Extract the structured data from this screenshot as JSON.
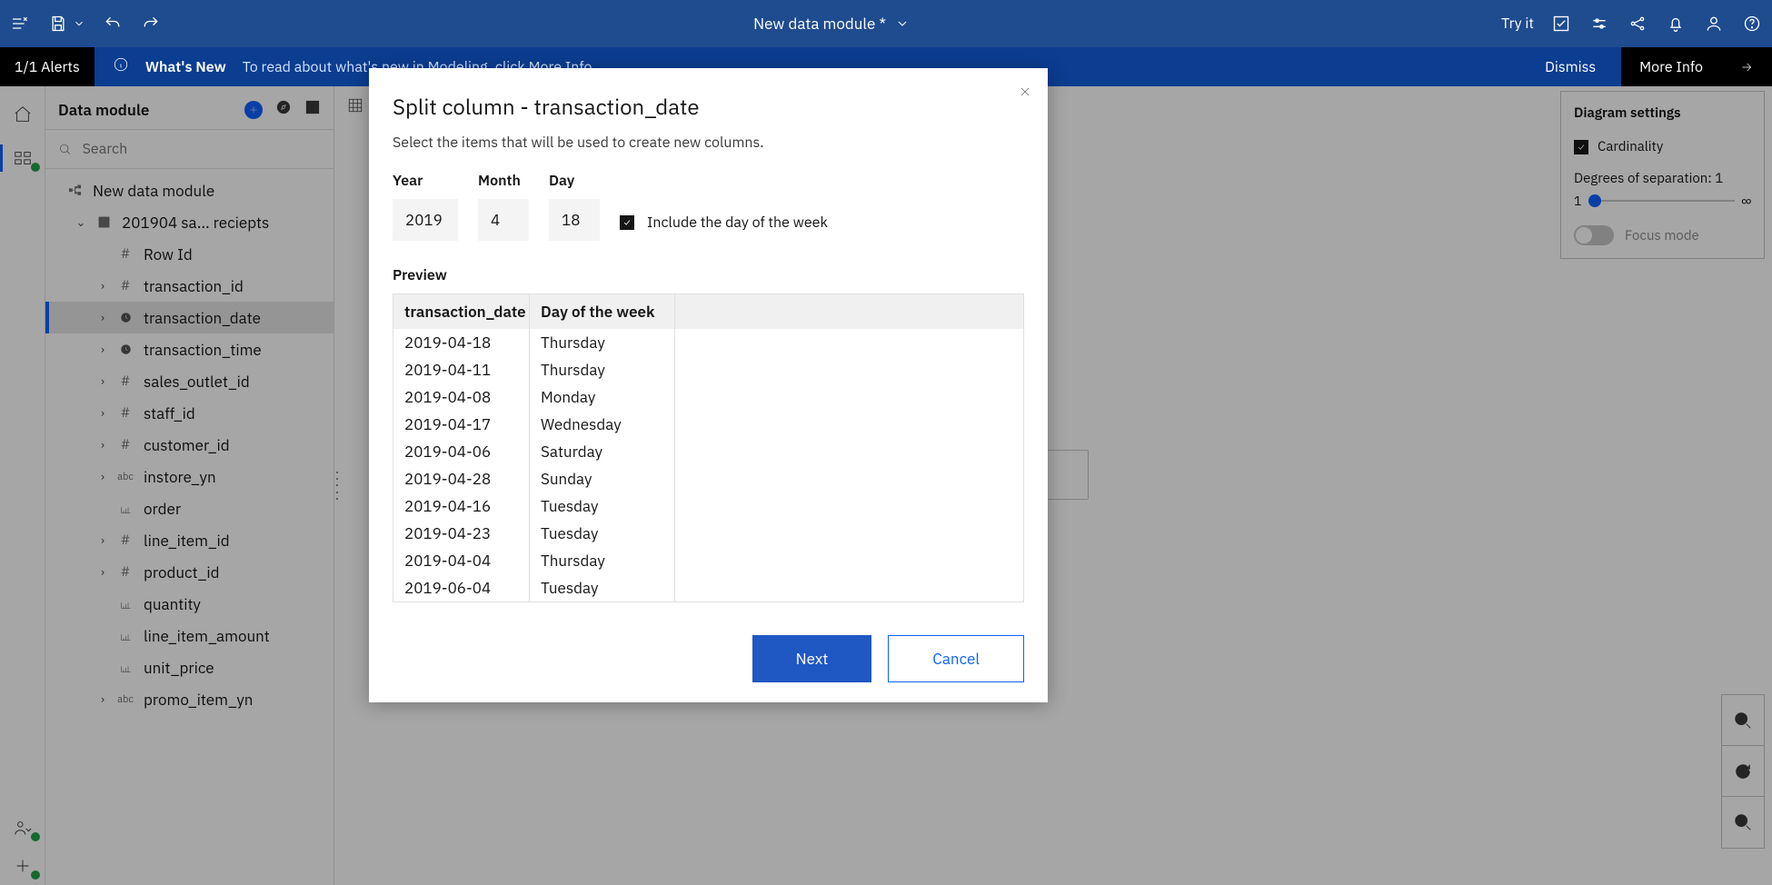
{
  "topbar": {
    "title": "New data module *",
    "try_it": "Try it"
  },
  "alertbar": {
    "badge": "1/1 Alerts",
    "title": "What's New",
    "message": "To read about what's new in Modeling, click More Info.",
    "dismiss": "Dismiss",
    "more_info": "More Info"
  },
  "tree": {
    "header": "Data module",
    "search_placeholder": "Search",
    "root": "New data module",
    "table": "201904 sa... reciepts",
    "columns": [
      {
        "label": "Row Id",
        "type": "hash",
        "caret": false
      },
      {
        "label": "transaction_id",
        "type": "hash",
        "caret": true
      },
      {
        "label": "transaction_date",
        "type": "time",
        "caret": true,
        "selected": true
      },
      {
        "label": "transaction_time",
        "type": "time",
        "caret": true
      },
      {
        "label": "sales_outlet_id",
        "type": "hash",
        "caret": true
      },
      {
        "label": "staff_id",
        "type": "hash",
        "caret": true
      },
      {
        "label": "customer_id",
        "type": "hash",
        "caret": true
      },
      {
        "label": "instore_yn",
        "type": "abc",
        "caret": true
      },
      {
        "label": "order",
        "type": "measure",
        "caret": false
      },
      {
        "label": "line_item_id",
        "type": "hash",
        "caret": true
      },
      {
        "label": "product_id",
        "type": "hash",
        "caret": true
      },
      {
        "label": "quantity",
        "type": "measure",
        "caret": false
      },
      {
        "label": "line_item_amount",
        "type": "measure",
        "caret": false
      },
      {
        "label": "unit_price",
        "type": "measure",
        "caret": false
      },
      {
        "label": "promo_item_yn",
        "type": "abc",
        "caret": true
      }
    ]
  },
  "diagram": {
    "header": "Diagram settings",
    "cardinality": "Cardinality",
    "degrees_label": "Degrees of separation: 1",
    "slider_min": "1",
    "slider_max": "∞",
    "focus_mode": "Focus mode"
  },
  "modal": {
    "title": "Split column - transaction_date",
    "subtitle": "Select the items that will be used to create new columns.",
    "year_label": "Year",
    "month_label": "Month",
    "day_label": "Day",
    "year_val": "2019",
    "month_val": "4",
    "day_val": "18",
    "include_dow": "Include the day of the week",
    "preview_label": "Preview",
    "col1": "transaction_date",
    "col2": "Day of the week",
    "rows": [
      {
        "d": "2019-04-18",
        "w": "Thursday"
      },
      {
        "d": "2019-04-11",
        "w": "Thursday"
      },
      {
        "d": "2019-04-08",
        "w": "Monday"
      },
      {
        "d": "2019-04-17",
        "w": "Wednesday"
      },
      {
        "d": "2019-04-06",
        "w": "Saturday"
      },
      {
        "d": "2019-04-28",
        "w": "Sunday"
      },
      {
        "d": "2019-04-16",
        "w": "Tuesday"
      },
      {
        "d": "2019-04-23",
        "w": "Tuesday"
      },
      {
        "d": "2019-04-04",
        "w": "Thursday"
      },
      {
        "d": "2019-06-04",
        "w": "Tuesday"
      }
    ],
    "next": "Next",
    "cancel": "Cancel"
  }
}
